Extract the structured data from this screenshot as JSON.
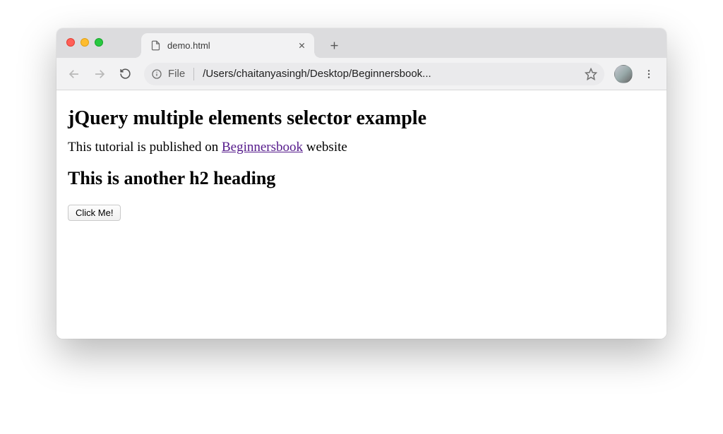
{
  "window": {
    "tab": {
      "title": "demo.html"
    },
    "omnibox": {
      "scheme": "File",
      "path": "/Users/chaitanyasingh/Desktop/Beginnersbook..."
    }
  },
  "page": {
    "heading1": "jQuery multiple elements selector example",
    "paragraph_before": "This tutorial is published on ",
    "link_text": "Beginnersbook",
    "paragraph_after": " website",
    "heading2": "This is another h2 heading",
    "button_label": "Click Me!"
  }
}
